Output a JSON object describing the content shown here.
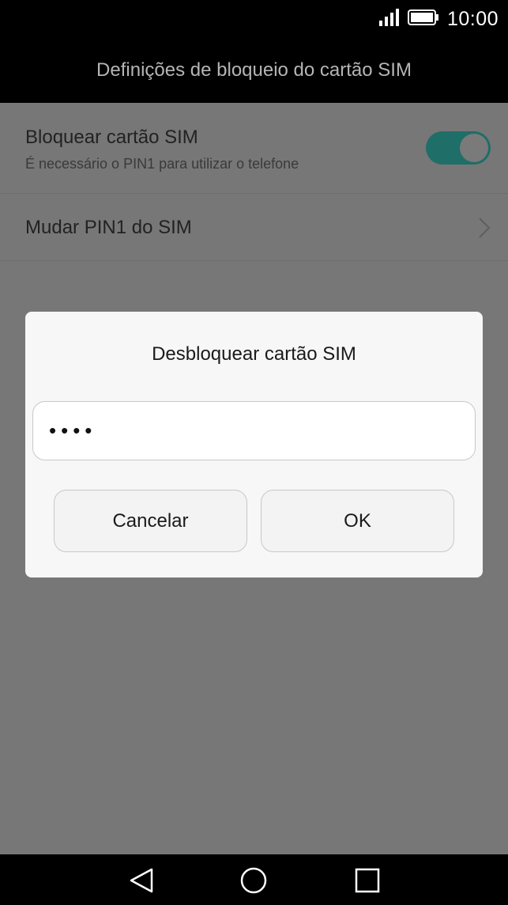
{
  "status_bar": {
    "time": "10:00",
    "icons": [
      "signal-icon",
      "battery-icon"
    ]
  },
  "header": {
    "title": "Definições de bloqueio do cartão SIM"
  },
  "settings": {
    "lock_sim": {
      "title": "Bloquear cartão SIM",
      "subtitle": "É necessário o PIN1 para utilizar o telefone",
      "toggle_on": true
    },
    "change_pin": {
      "title": "Mudar PIN1 do SIM"
    }
  },
  "dialog": {
    "title": "Desbloquear cartão SIM",
    "pin_value": "••••",
    "cancel_label": "Cancelar",
    "ok_label": "OK"
  },
  "navigation": {
    "icons": [
      "back-icon",
      "home-icon",
      "recents-icon"
    ]
  },
  "colors": {
    "toggle_accent": "#1f6e68",
    "scrim": "#777777"
  }
}
